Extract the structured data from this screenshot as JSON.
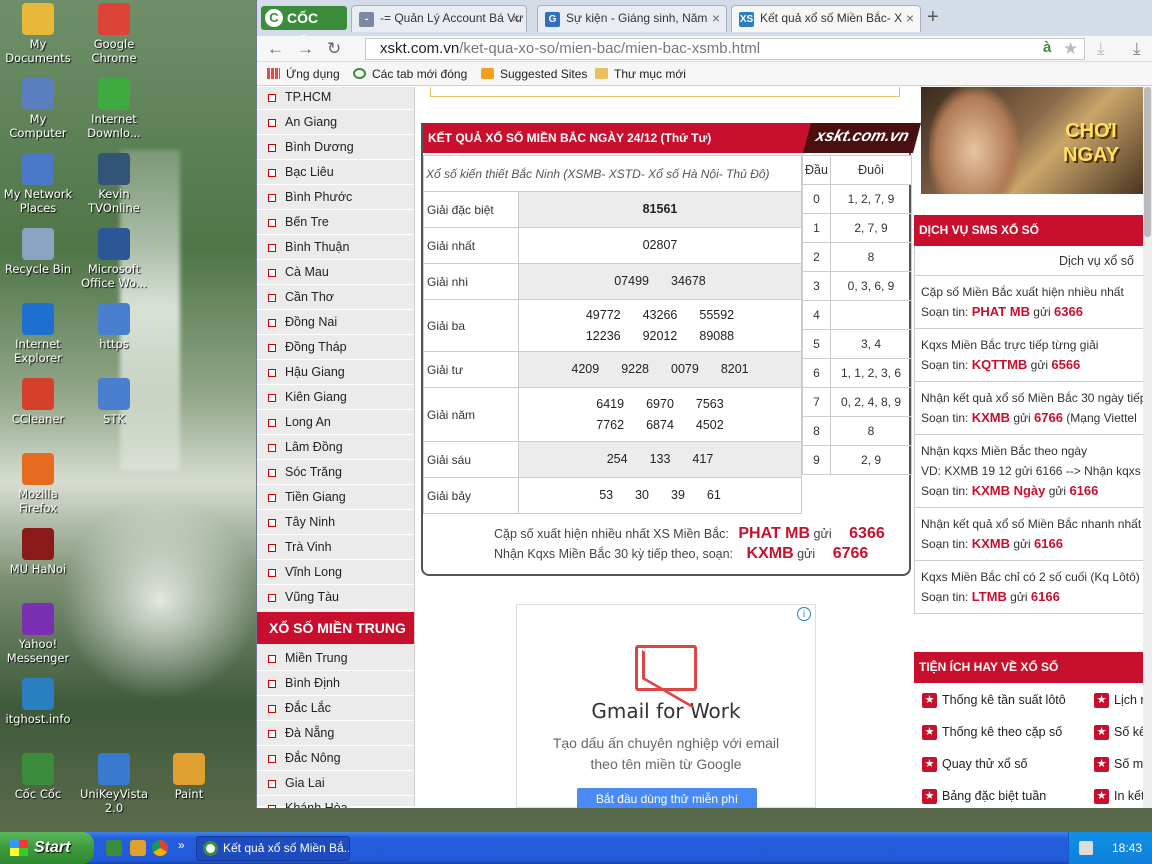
{
  "desktop": {
    "icons": [
      {
        "label": "My Documents",
        "color": "#e8b83a"
      },
      {
        "label": "Google Chrome",
        "color": "#db4437"
      },
      {
        "label": "My Computer",
        "color": "#5a7fbf"
      },
      {
        "label": "Internet Downlo...",
        "color": "#3faa3f"
      },
      {
        "label": "My Network Places",
        "color": "#4a79c8"
      },
      {
        "label": "Kevin TVOnline",
        "color": "#335577"
      },
      {
        "label": "Recycle Bin",
        "color": "#8aa3c0"
      },
      {
        "label": "Microsoft Office Wo...",
        "color": "#2b5797"
      },
      {
        "label": "Internet Explorer",
        "color": "#1f6fd1"
      },
      {
        "label": "https",
        "color": "#4a7fd0"
      },
      {
        "label": "CCleaner",
        "color": "#d4402a"
      },
      {
        "label": "STK",
        "color": "#4a7fd0"
      },
      {
        "label": "Mozilla Firefox",
        "color": "#e66b1f"
      },
      {
        "label": "MU HaNoi",
        "color": "#8a1a1a"
      },
      {
        "label": "Yahoo! Messenger",
        "color": "#7b2fb3"
      },
      {
        "label": "itghost.info",
        "color": "#2a7fc0"
      },
      {
        "label": "Cốc Cốc",
        "color": "#3b8d3b"
      },
      {
        "label": "UniKeyVista 2.0",
        "color": "#3a7ad0"
      },
      {
        "label": "Paint",
        "color": "#e0a030"
      }
    ]
  },
  "browser": {
    "brand": "CỐC CỐC",
    "tabs": [
      {
        "label": "-= Quản Lý Account Bá Vư",
        "fav": "-",
        "fav_color": "#7a8aa0"
      },
      {
        "label": "Sự kiện - Giáng sinh, Năm",
        "fav": "G",
        "fav_color": "#2f6fc0"
      },
      {
        "label": "Kết quả xổ số Miền Bắc- X",
        "fav": "XS",
        "fav_color": "#2a7fc0"
      }
    ],
    "address_host": "xskt.com.vn",
    "address_path": "/ket-qua-xo-so/mien-bac/mien-bac-xsmb.html",
    "bookmarks": [
      "Ứng dụng",
      "Các tab mới đóng",
      "Suggested Sites",
      "Thư mục mới"
    ]
  },
  "leftmenu": {
    "south": [
      "TP.HCM",
      "An Giang",
      "Bình Dương",
      "Bạc Liêu",
      "Bình Phước",
      "Bến Tre",
      "Bình Thuận",
      "Cà Mau",
      "Cần Thơ",
      "Đồng Nai",
      "Đồng Tháp",
      "Hậu Giang",
      "Kiên Giang",
      "Long An",
      "Lâm Đồng",
      "Sóc Trăng",
      "Tiền Giang",
      "Tây Ninh",
      "Trà Vinh",
      "Vĩnh Long",
      "Vũng Tàu"
    ],
    "central_header": "XỔ SỐ MIỀN TRUNG",
    "central": [
      "Miền Trung",
      "Bình Định",
      "Đắc Lắc",
      "Đà Nẵng",
      "Đắc Nông",
      "Gia Lai",
      "Khánh Hòa"
    ]
  },
  "results": {
    "header": "KẾT QUẢ XỔ SỐ MIỀN BẮC NGÀY 24/12 (Thứ Tư)",
    "brand": "xskt.com.vn",
    "subtitle": "Xổ số kiến thiết Bắc Ninh (XSMB- XSTD- Xổ số Hà Nội- Thủ Đô)",
    "prizes": [
      {
        "label": "Giải đặc biệt",
        "rows": [
          [
            "81561"
          ]
        ],
        "special": true
      },
      {
        "label": "Giải nhất",
        "rows": [
          [
            "02807"
          ]
        ]
      },
      {
        "label": "Giải nhì",
        "rows": [
          [
            "07499",
            "34678"
          ]
        ]
      },
      {
        "label": "Giải ba",
        "rows": [
          [
            "49772",
            "43266",
            "55592"
          ],
          [
            "12236",
            "92012",
            "89088"
          ]
        ]
      },
      {
        "label": "Giải tư",
        "rows": [
          [
            "4209",
            "9228",
            "0079",
            "8201"
          ]
        ]
      },
      {
        "label": "Giải năm",
        "rows": [
          [
            "6419",
            "6970",
            "7563"
          ],
          [
            "7762",
            "6874",
            "4502"
          ]
        ]
      },
      {
        "label": "Giải sáu",
        "rows": [
          [
            "254",
            "133",
            "417"
          ]
        ]
      },
      {
        "label": "Giải bảy",
        "rows": [
          [
            "53",
            "30",
            "39",
            "61"
          ]
        ]
      }
    ],
    "loto_head": [
      "Đầu",
      "Đuôi"
    ],
    "loto": [
      [
        "0",
        "1, 2, 7, 9"
      ],
      [
        "1",
        "2, 7, 9"
      ],
      [
        "2",
        "8"
      ],
      [
        "3",
        "0, 3, 6, 9"
      ],
      [
        "4",
        ""
      ],
      [
        "5",
        "3, 4"
      ],
      [
        "6",
        "1, 1, 2, 3, 6"
      ],
      [
        "7",
        "0, 2, 4, 8, 9"
      ],
      [
        "8",
        "8"
      ],
      [
        "9",
        "2, 9"
      ]
    ],
    "sms1_text": "Cặp số xuất hiện nhiều nhất XS Miền Bắc:",
    "sms1_code": "PHAT MB",
    "sms1_gui": "gửi",
    "sms1_num": "6366",
    "sms2_text": "Nhận Kqxs Miền Bắc 30 kỳ tiếp theo, soạn:",
    "sms2_code": "KXMB",
    "sms2_gui": "gửi",
    "sms2_num": "6766"
  },
  "ad": {
    "title": "Gmail for Work",
    "line1": "Tạo dấu ấn chuyên nghiệp với email",
    "line2": "theo tên miền từ Google",
    "cta": "Bắt đầu dùng thử miễn phí",
    "info": "i"
  },
  "right": {
    "game_btn1": "CHƠI",
    "game_btn2": "NGAY",
    "sms_header": "DỊCH VỤ SMS XỔ SỐ",
    "sms_sub": "Dịch vụ xổ số",
    "sms_items": [
      {
        "l1": "Cặp số Miền Bắc xuất hiện nhiều nhất",
        "pre": "Soạn tin: ",
        "code": "PHAT MB",
        "mid": " gửi ",
        "num": "6366",
        "post": ""
      },
      {
        "l1": "Kqxs Miền Bắc trực tiếp từng giải",
        "pre": "Soạn tin: ",
        "code": "KQTTMB",
        "mid": " gửi ",
        "num": "6566",
        "post": ""
      },
      {
        "l1": "Nhận kết quả xổ số Miền Bắc 30 ngày tiếp",
        "pre": "Soạn tin: ",
        "code": "KXMB",
        "mid": " gửi ",
        "num": "6766",
        "post": " (Mạng Viettel"
      },
      {
        "l1": "Nhận kqxs Miền Bắc theo ngày",
        "l1b": "VD: KXMB 19 12 gửi 6166 --> Nhận kqxs",
        "pre": "Soạn tin: ",
        "code": "KXMB Ngày",
        "mid": " gửi ",
        "num": "6166",
        "post": ""
      },
      {
        "l1": "Nhận kết quả xổ số Miền Bắc nhanh nhất",
        "pre": "Soạn tin: ",
        "code": "KXMB",
        "mid": " gửi ",
        "num": "6166",
        "post": ""
      },
      {
        "l1": "Kqxs Miền Bắc chỉ có 2 số cuối (Kq Lôtô)",
        "pre": "Soạn tin: ",
        "code": "LTMB",
        "mid": " gửi ",
        "num": "6166",
        "post": ""
      }
    ],
    "tienich_header": "TIỆN ÍCH HAY VỀ XỔ SỐ",
    "tienich": [
      [
        "Thống kê tần suất lôtô",
        "Lịch m"
      ],
      [
        "Thống kê theo cặp số",
        "Số kế"
      ],
      [
        "Quay thử xổ số",
        "Số m"
      ],
      [
        "Bảng đặc biệt tuần",
        "In kết"
      ]
    ]
  },
  "taskbar": {
    "start": "Start",
    "task": "Kết quả xổ số Miền Bắ...",
    "time": "18:43"
  }
}
